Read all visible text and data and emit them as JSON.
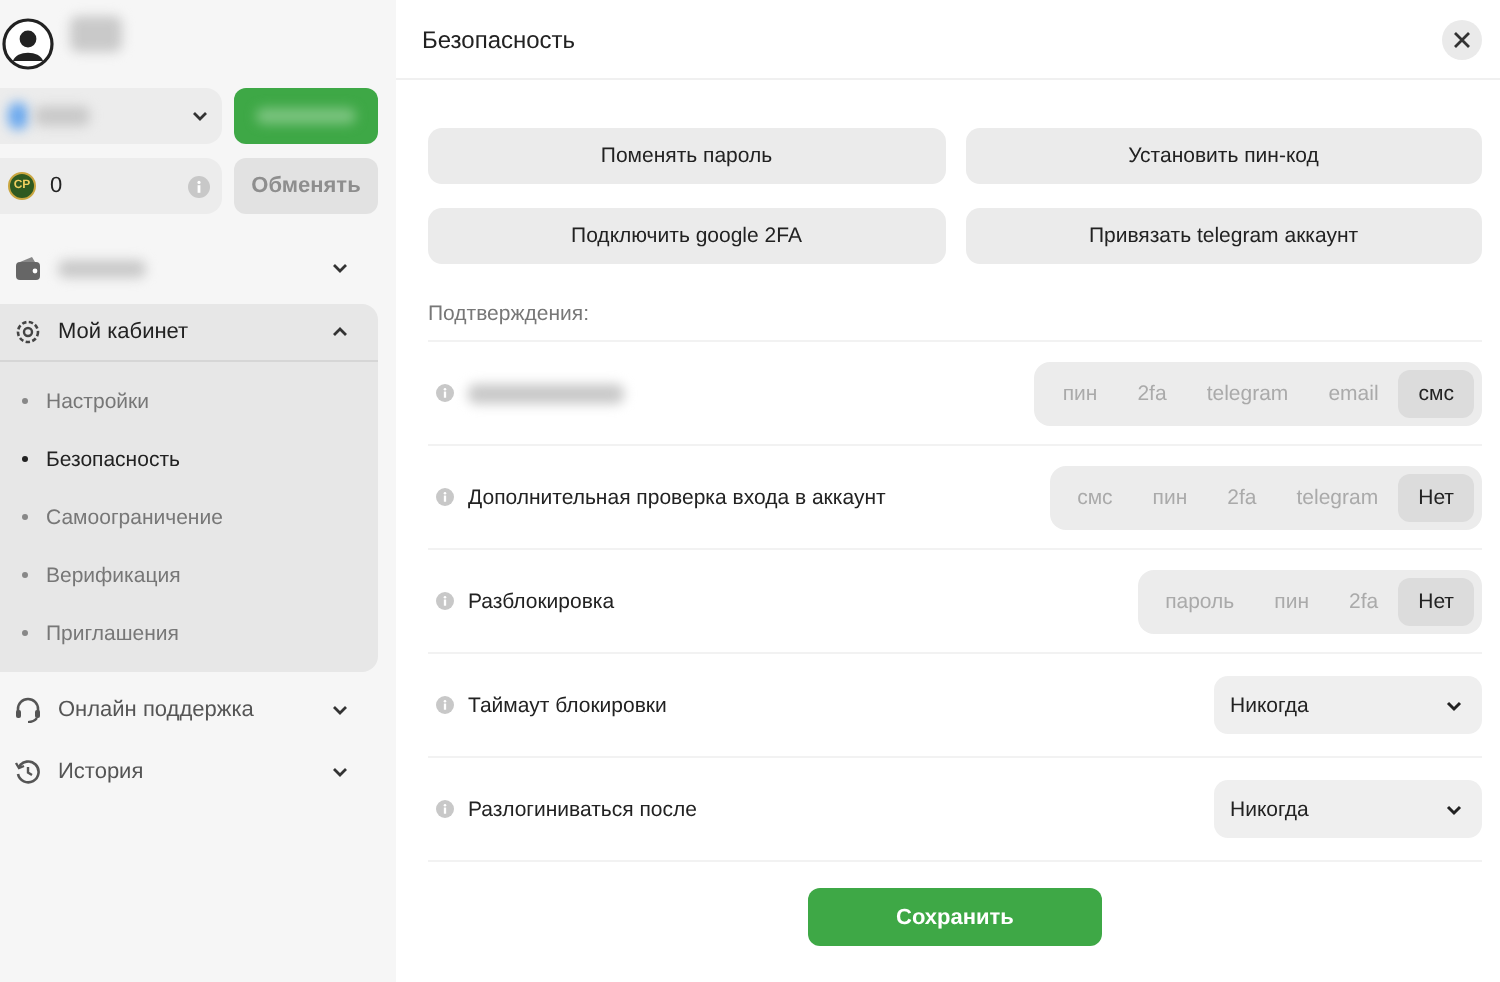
{
  "balance": {
    "coin_label": "CP",
    "amount": "0",
    "exchange_button": {
      "label": "Обменять",
      "disabled": true
    }
  },
  "sidebar": {
    "items": [
      {
        "kind": "wallet",
        "expanded": false
      },
      {
        "kind": "settings",
        "label": "Мой кабинет",
        "expanded": true,
        "children": [
          {
            "label": "Настройки",
            "selected": false
          },
          {
            "label": "Безопасность",
            "selected": true
          },
          {
            "label": "Самоограничение",
            "selected": false
          },
          {
            "label": "Верификация",
            "selected": false
          },
          {
            "label": "Приглашения",
            "selected": false
          }
        ]
      },
      {
        "kind": "support",
        "label": "Онлайн поддержка",
        "expanded": false
      },
      {
        "kind": "history",
        "label": "История",
        "expanded": false
      }
    ]
  },
  "dialog": {
    "title": "Безопасность",
    "actions": [
      "Поменять пароль",
      "Установить пин-код",
      "Подключить google 2FA",
      "Привязать telegram аккаунт"
    ],
    "confirmations_label": "Подтверждения:",
    "rows": [
      {
        "kind": "segmented",
        "options": [
          {
            "label": "пин",
            "selected": false
          },
          {
            "label": "2fa",
            "selected": false
          },
          {
            "label": "telegram",
            "selected": false
          },
          {
            "label": "email",
            "selected": false
          },
          {
            "label": "смс",
            "selected": true
          }
        ]
      },
      {
        "kind": "segmented",
        "label": "Дополнительная проверка входа в аккаунт",
        "options": [
          {
            "label": "смс",
            "selected": false
          },
          {
            "label": "пин",
            "selected": false
          },
          {
            "label": "2fa",
            "selected": false
          },
          {
            "label": "telegram",
            "selected": false
          },
          {
            "label": "Нет",
            "selected": true
          }
        ]
      },
      {
        "kind": "segmented",
        "label": "Разблокировка",
        "options": [
          {
            "label": "пароль",
            "selected": false
          },
          {
            "label": "пин",
            "selected": false
          },
          {
            "label": "2fa",
            "selected": false
          },
          {
            "label": "Нет",
            "selected": true
          }
        ]
      },
      {
        "kind": "select",
        "label": "Таймаут блокировки",
        "value": "Никогда"
      },
      {
        "kind": "select",
        "label": "Разлогиниваться после",
        "value": "Никогда"
      }
    ],
    "save_button": "Сохранить"
  }
}
